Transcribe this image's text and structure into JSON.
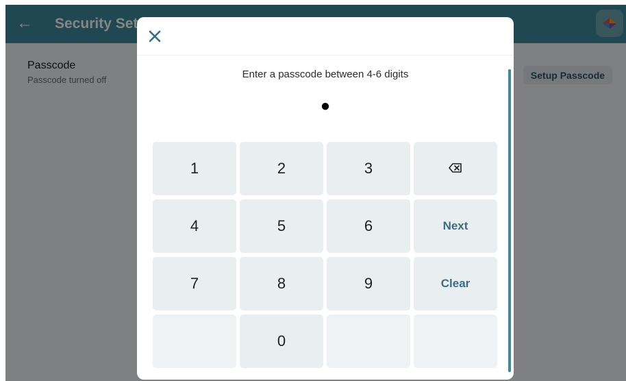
{
  "app": {
    "title": "Security Settings",
    "back_icon": "arrow-left-icon",
    "logo_icon": "app-logo-icon",
    "colors": {
      "primary": "#3e8a99",
      "key_bg": "#e9eff1",
      "action_text": "#3b6d80"
    }
  },
  "passcode_row": {
    "title": "Passcode",
    "subtitle": "Passcode turned off",
    "button_label": "Setup Passcode"
  },
  "dialog": {
    "close_icon": "close-icon",
    "prompt": "Enter a passcode between 4-6 digits",
    "entered_dots": "●",
    "keys": {
      "k1": "1",
      "k2": "2",
      "k3": "3",
      "k4": "4",
      "k5": "5",
      "k6": "6",
      "k7": "7",
      "k8": "8",
      "k9": "9",
      "k0": "0",
      "backspace_icon": "backspace-icon",
      "next": "Next",
      "clear": "Clear"
    }
  }
}
